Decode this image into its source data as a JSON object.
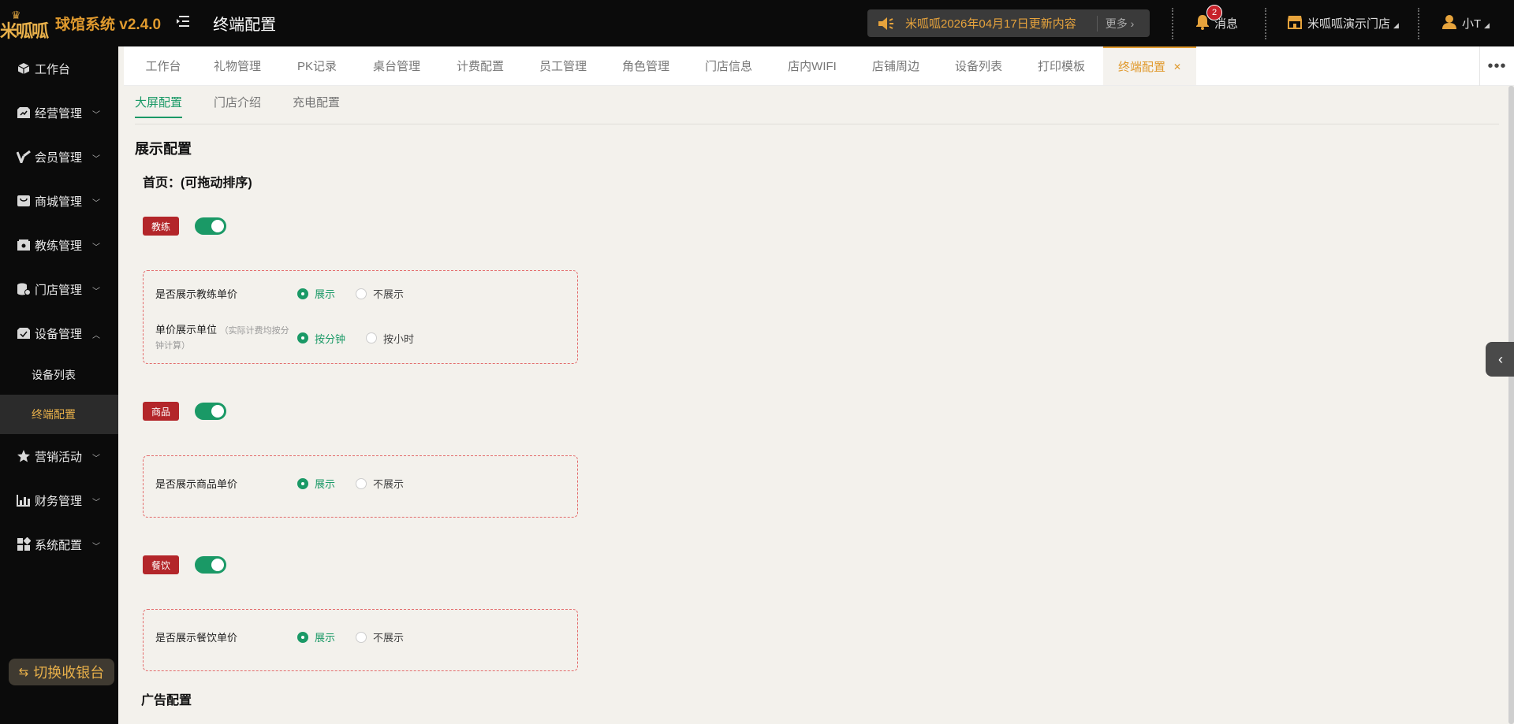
{
  "header": {
    "logo_text": "米呱呱",
    "app_name": "球馆系统 v2.4.0",
    "page_title": "终端配置",
    "notice_text": "米呱呱2026年04月17日更新内容",
    "notice_more": "更多",
    "messages_label": "消息",
    "messages_count": "2",
    "store_name": "米呱呱演示门店",
    "user_name": "小T"
  },
  "sidebar": {
    "items": [
      {
        "label": "工作台",
        "icon": "cube-icon"
      },
      {
        "label": "经营管理",
        "icon": "store-icon"
      },
      {
        "label": "会员管理",
        "icon": "member-icon"
      },
      {
        "label": "商城管理",
        "icon": "bag-icon"
      },
      {
        "label": "教练管理",
        "icon": "coach-icon"
      },
      {
        "label": "门店管理",
        "icon": "coins-icon"
      },
      {
        "label": "设备管理",
        "icon": "device-icon"
      },
      {
        "label": "营销活动",
        "icon": "star-icon"
      },
      {
        "label": "财务管理",
        "icon": "chart-icon"
      },
      {
        "label": "系统配置",
        "icon": "grid-icon"
      }
    ],
    "sub_items": [
      {
        "label": "设备列表"
      },
      {
        "label": "终端配置"
      }
    ],
    "switch_label": "切换收银台"
  },
  "tabs": [
    {
      "label": "工作台"
    },
    {
      "label": "礼物管理"
    },
    {
      "label": "PK记录"
    },
    {
      "label": "桌台管理"
    },
    {
      "label": "计费配置"
    },
    {
      "label": "员工管理"
    },
    {
      "label": "角色管理"
    },
    {
      "label": "门店信息"
    },
    {
      "label": "店内WIFI"
    },
    {
      "label": "店铺周边"
    },
    {
      "label": "设备列表"
    },
    {
      "label": "打印模板"
    },
    {
      "label": "终端配置"
    }
  ],
  "subtabs": [
    {
      "label": "大屏配置"
    },
    {
      "label": "门店介绍"
    },
    {
      "label": "充电配置"
    }
  ],
  "content": {
    "display_title": "展示配置",
    "home_title": "首页：(可拖动排序)",
    "blocks": [
      {
        "tag": "教练",
        "enabled": true,
        "rows": [
          {
            "label": "是否展示教练单价",
            "hint": "",
            "options": [
              "展示",
              "不展示"
            ],
            "selected": "展示"
          },
          {
            "label": "单价展示单位",
            "hint": "（实际计费均按分钟计算）",
            "options": [
              "按分钟",
              "按小时"
            ],
            "selected": "按分钟"
          }
        ]
      },
      {
        "tag": "商品",
        "enabled": true,
        "rows": [
          {
            "label": "是否展示商品单价",
            "hint": "",
            "options": [
              "展示",
              "不展示"
            ],
            "selected": "展示"
          }
        ]
      },
      {
        "tag": "餐饮",
        "enabled": true,
        "rows": [
          {
            "label": "是否展示餐饮单价",
            "hint": "",
            "options": [
              "展示",
              "不展示"
            ],
            "selected": "展示"
          }
        ]
      }
    ],
    "ad_title": "广告配置"
  },
  "colors": {
    "accent_green": "#1a9966",
    "accent_gold": "#e09a2e",
    "tag_red": "#b3262a",
    "dashed_border": "#e36b6b"
  }
}
